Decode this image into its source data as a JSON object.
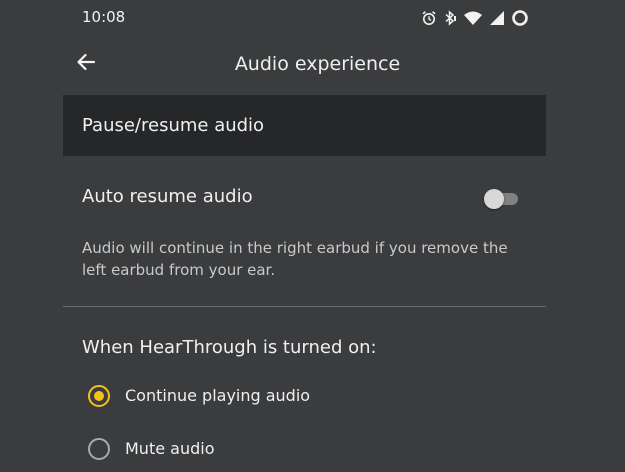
{
  "status_bar": {
    "time": "10:08",
    "icons": [
      "alarm-icon",
      "bluetooth-icon",
      "wifi-icon",
      "signal-icon",
      "battery-icon"
    ]
  },
  "app_bar": {
    "back_icon": "back-arrow-icon",
    "title": "Audio experience"
  },
  "section": {
    "title": "Pause/resume audio"
  },
  "auto_resume": {
    "label": "Auto resume audio",
    "enabled": false,
    "description": "Audio will continue in the right earbud if you remove the left earbud from your ear."
  },
  "hearthrough": {
    "heading": "When HearThrough is turned on:",
    "options": [
      {
        "label": "Continue playing audio",
        "selected": true
      },
      {
        "label": "Mute audio",
        "selected": false
      }
    ]
  },
  "colors": {
    "background": "#3b3c3e",
    "header_band": "#262729",
    "accent": "#f2c21b"
  }
}
